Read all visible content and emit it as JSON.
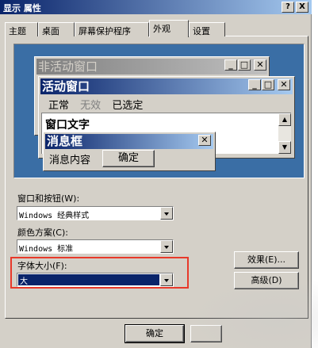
{
  "window": {
    "title": "显示 属性",
    "help_btn": "?",
    "close_btn": "X"
  },
  "tabs": [
    {
      "label": "主题"
    },
    {
      "label": "桌面"
    },
    {
      "label": "屏幕保护程序"
    },
    {
      "label": "外观"
    },
    {
      "label": "设置"
    }
  ],
  "preview": {
    "inactive_title": "非活动窗口",
    "active_title": "活动窗口",
    "menu": {
      "normal": "正常",
      "disabled": "无效",
      "selected": "已选定"
    },
    "window_text": "窗口文字",
    "msgbox_title": "消息框",
    "msgbox_text": "消息内容",
    "msgbox_ok": "确定"
  },
  "controls": {
    "window_style_label": "窗口和按钮(W):",
    "window_style_value": "Windows 经典样式",
    "color_scheme_label": "颜色方案(C):",
    "color_scheme_value": "Windows 标准",
    "font_size_label": "字体大小(F):",
    "font_size_value": "大",
    "effects_button": "效果(E)...",
    "advanced_button": "高级(D)"
  },
  "footer": {
    "ok_button": "确定"
  },
  "colors": {
    "titlebar": "#0a246a",
    "desktop": "#3a6ea5",
    "highlight_box": "#e8392a"
  }
}
